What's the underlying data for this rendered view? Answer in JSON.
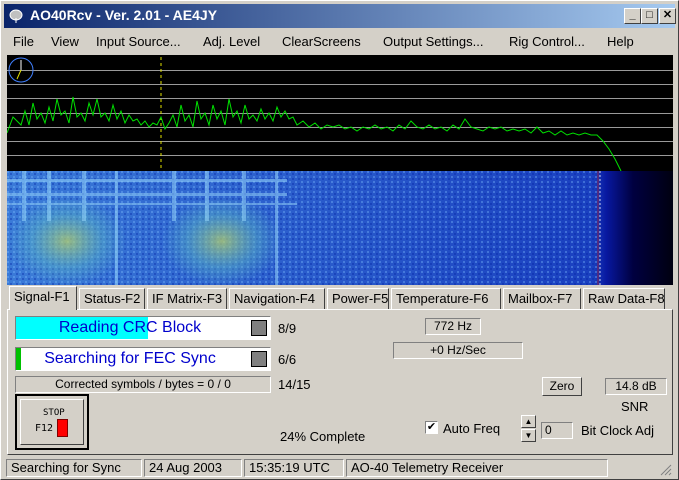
{
  "window": {
    "title": "AO40Rcv - Ver. 2.01 - AE4JY",
    "controls": {
      "minimize": "_",
      "maximize": "□",
      "close": "✕"
    }
  },
  "menu": [
    "File",
    "View",
    "Input Source...",
    "Adj. Level",
    "ClearScreens",
    "Output Settings...",
    "Rig Control...",
    "Help"
  ],
  "tabs": [
    "Signal-F1",
    "Status-F2",
    "IF Matrix-F3",
    "Navigation-F4",
    "Power-F5",
    "Temperature-F6",
    "Mailbox-F7",
    "Raw Data-F8"
  ],
  "active_tab": "Signal-F1",
  "signal": {
    "crc_bar": {
      "label": "Reading CRC Block",
      "count": "8/9",
      "progress": 0.52,
      "color": "#00ffff"
    },
    "fec_bar": {
      "label": "Searching for FEC Sync",
      "count": "6/6",
      "progress": 0.02,
      "color": "#00c000"
    },
    "corrected": {
      "label": "Corrected symbols / bytes = 0 / 0",
      "count": "14/15"
    },
    "freq_offset": "772 Hz",
    "drift": "+0 Hz/Sec",
    "zero_button": "Zero",
    "snr_value": "14.8 dB",
    "snr_label": "SNR",
    "stop_button": {
      "line1": "STOP",
      "line2": "F12"
    },
    "complete": "24% Complete",
    "auto_freq": {
      "label": "Auto Freq",
      "checked": true
    },
    "bit_clock": {
      "value": "0",
      "label": "Bit Clock Adj"
    }
  },
  "status": [
    "Searching for Sync",
    "24 Aug 2003",
    "15:35:19 UTC",
    "AO-40 Telemetry Receiver"
  ],
  "colors": {
    "trace": "#00e000",
    "marker": "#e0e000",
    "waterfall_base": "#1040d0"
  }
}
